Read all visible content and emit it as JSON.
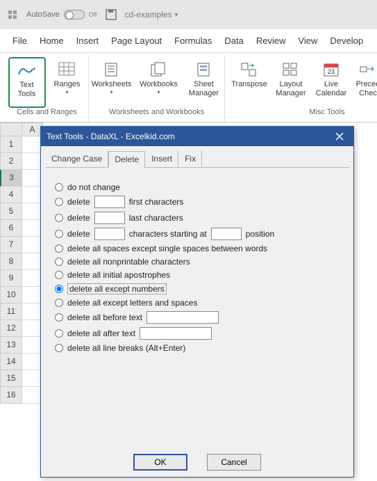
{
  "titlebar": {
    "autosave_label": "AutoSave",
    "autosave_state": "Off",
    "doc_name": "cd-examples",
    "doc_caret": "▾"
  },
  "menu": {
    "file": "File",
    "home": "Home",
    "insert": "Insert",
    "page_layout": "Page Layout",
    "formulas": "Formulas",
    "data": "Data",
    "review": "Review",
    "view": "View",
    "developer": "Develop"
  },
  "ribbon": {
    "text_tools": "Text Tools",
    "ranges": "Ranges",
    "worksheets": "Worksheets",
    "workbooks": "Workbooks",
    "sheet_manager": "Sheet Manager",
    "transpose": "Transpose",
    "layout_manager": "Layout Manager",
    "live_calendar": "Live Calendar",
    "precedents_check": "Preced Chec",
    "group1": "Cells and Ranges",
    "group2": "Worksheets and Workbooks",
    "group3": "Misc Tools"
  },
  "colheaders": [
    "A"
  ],
  "rowheaders": [
    "1",
    "2",
    "3",
    "4",
    "5",
    "6",
    "7",
    "8",
    "9",
    "10",
    "11",
    "12",
    "13",
    "14",
    "15",
    "16"
  ],
  "selected_row": 3,
  "dialog": {
    "title": "Text Tools - DataXL - Excelkid.com",
    "tabs": {
      "change_case": "Change Case",
      "delete": "Delete",
      "insert": "Insert",
      "fix": "Fix"
    },
    "active_tab": "delete",
    "options": {
      "o1": "do not change",
      "o2a": "delete",
      "o2b": "first characters",
      "o3a": "delete",
      "o3b": "last characters",
      "o4a": "delete",
      "o4b": "characters starting at",
      "o4c": "position",
      "o5": "delete all spaces except single spaces between words",
      "o6": "delete all nonprintable characters",
      "o7": "delete all initial apostrophes",
      "o8": "delete all except numbers",
      "o9": "delete all except letters and spaces",
      "o10": "delete all before text",
      "o11": "delete all after text",
      "o12": "delete all line breaks (Alt+Enter)"
    },
    "selected": "o8",
    "ok": "OK",
    "cancel": "Cancel"
  }
}
